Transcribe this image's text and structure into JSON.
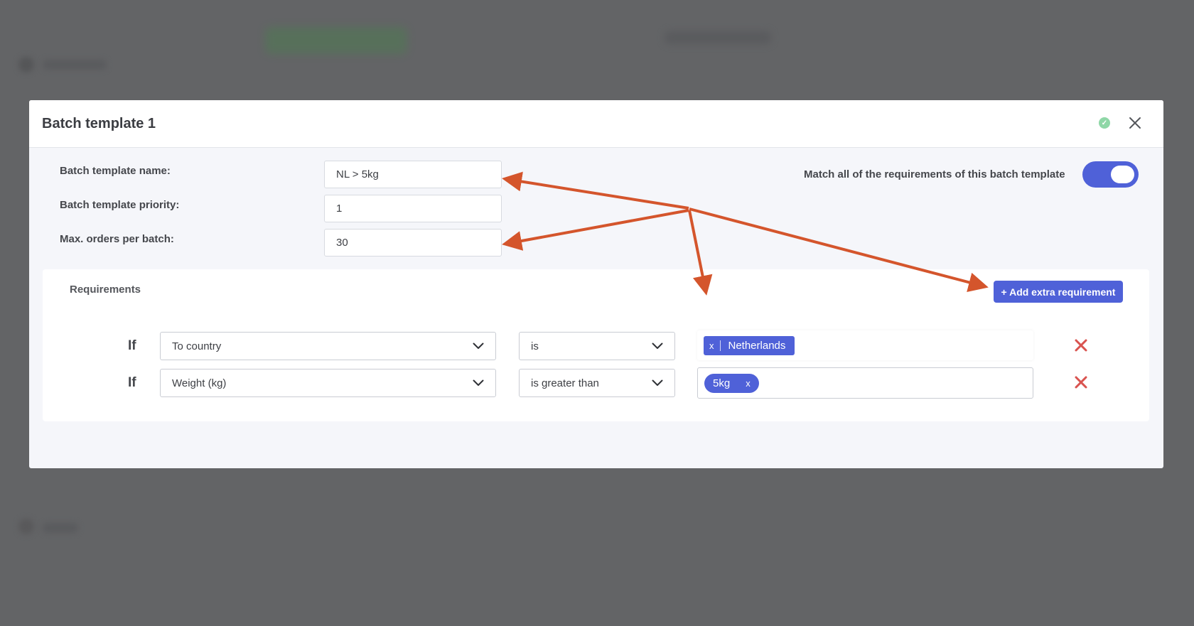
{
  "modal": {
    "title": "Batch template 1",
    "saved_icon": "check-circle-icon",
    "close_icon": "close-icon"
  },
  "form": {
    "name_label": "Batch template name:",
    "name_value": "NL > 5kg",
    "priority_label": "Batch template priority:",
    "priority_value": "1",
    "max_orders_label": "Max. orders per batch:",
    "max_orders_value": "30",
    "match_all_label": "Match all of the requirements of this batch template",
    "match_all_enabled": true
  },
  "requirements": {
    "title": "Requirements",
    "add_button_label": "+ Add extra requirement",
    "rows": [
      {
        "if_label": "If",
        "field": "To country",
        "operator": "is",
        "tag_remove": "x",
        "tag_value": "Netherlands"
      },
      {
        "if_label": "If",
        "field": "Weight (kg)",
        "operator": "is greater than",
        "tag_remove": "x",
        "tag_value": "5kg"
      }
    ]
  },
  "colors": {
    "accent": "#4f61d8",
    "remove": "#d9534f",
    "annotation_arrow": "#d4552c",
    "overlay": "#636466"
  }
}
